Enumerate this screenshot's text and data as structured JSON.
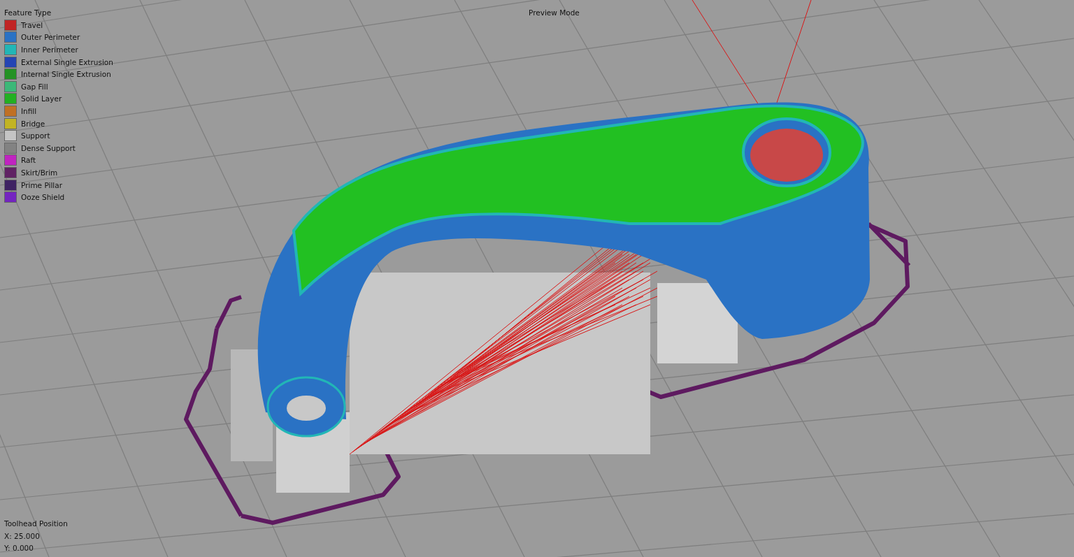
{
  "legend": {
    "title": "Feature Type",
    "items": [
      {
        "label": "Travel",
        "color": "#c02424"
      },
      {
        "label": "Outer Perimeter",
        "color": "#2a72c4"
      },
      {
        "label": "Inner Perimeter",
        "color": "#22b6b6"
      },
      {
        "label": "External Single Extrusion",
        "color": "#2444b4"
      },
      {
        "label": "Internal Single Extrusion",
        "color": "#249224"
      },
      {
        "label": "Gap Fill",
        "color": "#3cb878"
      },
      {
        "label": "Solid Layer",
        "color": "#22b022"
      },
      {
        "label": "Infill",
        "color": "#c07024"
      },
      {
        "label": "Bridge",
        "color": "#c2b424"
      },
      {
        "label": "Support",
        "color": "#c4c4c4"
      },
      {
        "label": "Dense Support",
        "color": "#828282"
      },
      {
        "label": "Raft",
        "color": "#c024c0"
      },
      {
        "label": "Skirt/Brim",
        "color": "#602264"
      },
      {
        "label": "Prime Pillar",
        "color": "#3e2262"
      },
      {
        "label": "Ooze Shield",
        "color": "#7424c0"
      }
    ]
  },
  "mode_label": "Preview Mode",
  "toolhead": {
    "title": "Toolhead Position",
    "x": "X: 25.000",
    "y": "Y: 0.000"
  }
}
